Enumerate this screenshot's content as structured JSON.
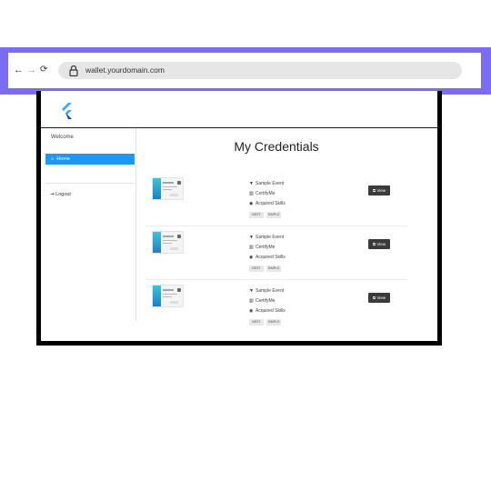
{
  "browser": {
    "back_glyph": "←",
    "forward_glyph": "→",
    "reload_glyph": "⟳",
    "url": "wallet.yourdomain.com"
  },
  "sidebar": {
    "welcome": "Welcome",
    "home_label": "Home",
    "logout_label": "Logout"
  },
  "main": {
    "title": "My Credentials",
    "view_label": "View",
    "credentials": [
      {
        "event": "Sample Event",
        "issuer": "CertifyMe",
        "skills": "Acquired Skills",
        "tag1": "BEST",
        "tag2": "SIMPLE"
      },
      {
        "event": "Sample Event",
        "issuer": "CertifyMe",
        "skills": "Acquired Skills",
        "tag1": "BEST",
        "tag2": "SIMPLE"
      },
      {
        "event": "Sample Event",
        "issuer": "CertifyMe",
        "skills": "Acquired Skills",
        "tag1": "BEST",
        "tag2": "SIMPLE"
      }
    ]
  },
  "colors": {
    "browser_frame": "#7b6cf6",
    "accent": "#2196f3",
    "view_button": "#3b3b3b"
  }
}
